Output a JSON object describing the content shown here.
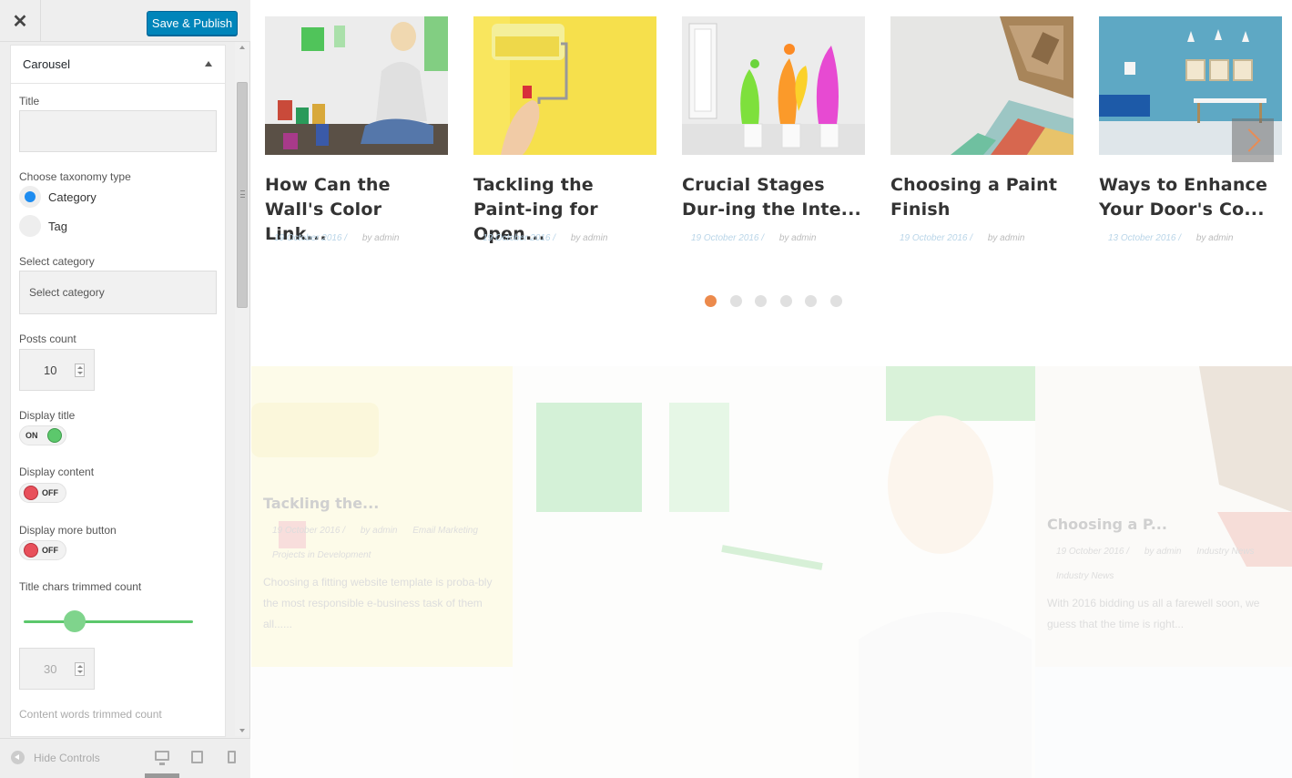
{
  "topbar": {
    "close_label": "✕",
    "publish_label": "Save & Publish"
  },
  "section": {
    "title": "Carousel"
  },
  "controls": {
    "title_label": "Title",
    "title_value": "",
    "taxonomy_label": "Choose taxonomy type",
    "taxonomy_options": [
      "Category",
      "Tag"
    ],
    "taxonomy_selected": "Category",
    "category_label": "Select category",
    "category_value": "Select category",
    "posts_count_label": "Posts count",
    "posts_count_value": "10",
    "display_title_label": "Display title",
    "display_title_state": "ON",
    "display_content_label": "Display content",
    "display_content_state": "OFF",
    "display_more_label": "Display more button",
    "display_more_state": "OFF",
    "title_chars_label": "Title chars trimmed count",
    "title_chars_value": "30",
    "title_chars_slider_fraction": 0.3,
    "content_words_label": "Content words trimmed count"
  },
  "footer": {
    "hide_controls_label": "Hide Controls",
    "devices": [
      "desktop",
      "tablet",
      "mobile"
    ],
    "active_device": "desktop"
  },
  "carousel": {
    "posts": [
      {
        "title": "How Can the Wall's Color Link...",
        "date": "19 October 2016 /",
        "author": "by admin"
      },
      {
        "title": "Tackling the Paint-ing for Open...",
        "date": "19 October 2016 /",
        "author": "by admin"
      },
      {
        "title": "Crucial Stages Dur-ing the Inte...",
        "date": "19 October 2016 /",
        "author": "by admin"
      },
      {
        "title": "Choosing a Paint Finish",
        "date": "19 October 2016 /",
        "author": "by admin"
      },
      {
        "title": "Ways to Enhance Your Door's Co...",
        "date": "13 October 2016 /",
        "author": "by admin"
      }
    ],
    "pagination_count": 6,
    "active_page": 1
  },
  "faded_grid": {
    "left": {
      "title": "Tackling the...",
      "date": "19 October 2016 /",
      "author": "by admin",
      "tags": [
        "Email Marketing",
        "Projects in Development"
      ],
      "excerpt": "Choosing a fitting website template is proba-bly the most responsible e-business task of them all......"
    },
    "right": {
      "title": "Choosing a P...",
      "date": "19 October 2016 /",
      "author": "by admin",
      "tags": [
        "Industry News",
        "Industry News"
      ],
      "excerpt": "With 2016 bidding us all a farewell soon, we guess that the time is right..."
    }
  },
  "colors": {
    "publish": "#0085ba",
    "accent": "#ec8a4c",
    "toggle_on": "#5cc86c",
    "toggle_off": "#e8505b",
    "radio": "#1e8cf0"
  }
}
